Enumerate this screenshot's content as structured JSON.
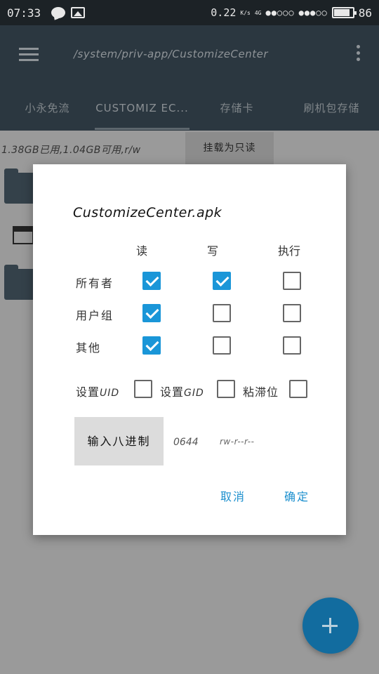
{
  "status_bar": {
    "time": "07:33",
    "net_speed": "0.22",
    "net_unit": "K/s",
    "net_type": "4G",
    "signal_1": "●●○○○",
    "signal_2": "●●●○○",
    "battery": "86"
  },
  "toolbar": {
    "path": "/system/priv-app/CustomizeCenter"
  },
  "tabs": [
    "小永免流",
    "CUSTOMIZ EC...",
    "存储卡",
    "刷机包存储"
  ],
  "storage": {
    "info": "1.38GB已用,1.04GB可用,r/w",
    "mount_button": "挂载为只读"
  },
  "dialog": {
    "title": "CustomizeCenter.apk",
    "columns": [
      "读",
      "写",
      "执行"
    ],
    "rows": [
      {
        "label": "所有者",
        "read": true,
        "write": true,
        "exec": false
      },
      {
        "label": "用户组",
        "read": true,
        "write": false,
        "exec": false
      },
      {
        "label": "其他",
        "read": true,
        "write": false,
        "exec": false
      }
    ],
    "special": {
      "uid_label": "设置",
      "uid_abbr": "UID",
      "gid_label": "设置",
      "gid_abbr": "GID",
      "sticky_label": "粘滞位"
    },
    "octal_button": "输入八进制",
    "octal_value": "0644",
    "perm_string": "rw-r--r--",
    "cancel": "取消",
    "ok": "确定"
  },
  "colors": {
    "accent": "#1a96d8",
    "toolbar": "#2b3740",
    "fab": "#126c9f"
  }
}
